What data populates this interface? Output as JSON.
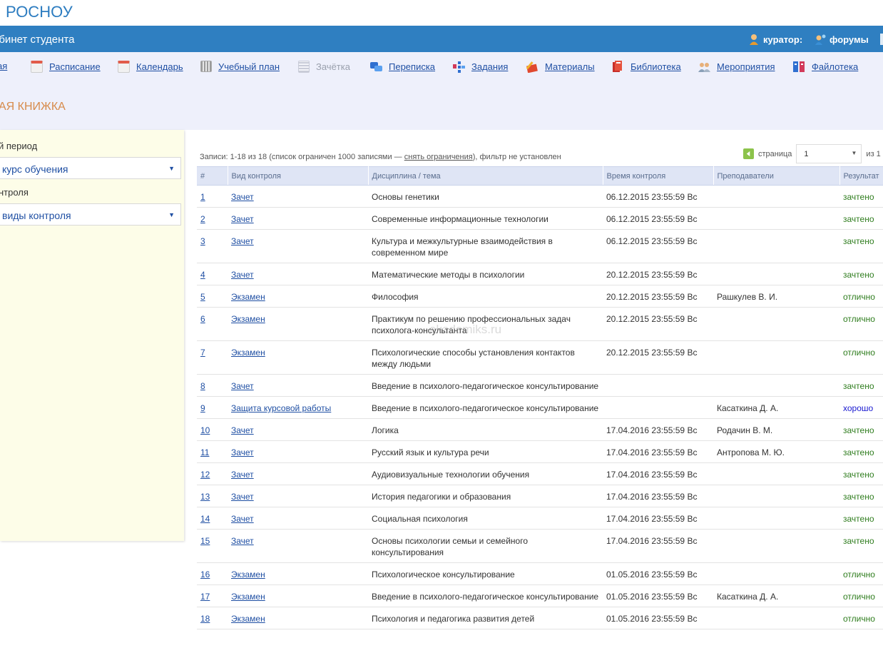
{
  "header": {
    "logo": "РОСНОУ",
    "cabinet_title": "абинет студента",
    "curator_label": "куратор:",
    "forums_label": "форумы"
  },
  "nav": {
    "items": [
      {
        "label": "ая",
        "icon": "home-icon"
      },
      {
        "label": "Расписание",
        "icon": "calendar-icon"
      },
      {
        "label": "Календарь",
        "icon": "calendar-icon"
      },
      {
        "label": "Учебный план",
        "icon": "grid-icon"
      },
      {
        "label": "Зачётка",
        "icon": "gradebook-icon"
      },
      {
        "label": "Переписка",
        "icon": "chat-icon"
      },
      {
        "label": "Задания",
        "icon": "tasks-icon"
      },
      {
        "label": "Материалы",
        "icon": "pencil-book-icon"
      },
      {
        "label": "Библиотека",
        "icon": "books-icon"
      },
      {
        "label": "Мероприятия",
        "icon": "people-icon"
      },
      {
        "label": "Файлотека",
        "icon": "files-icon"
      }
    ]
  },
  "page_title": "АЯ КНИЖКА",
  "sidebar": {
    "period_label": "й период",
    "period_value": "курс обучения",
    "control_label": "нтроля",
    "control_value": "виды контроля"
  },
  "records": {
    "prefix": "Записи: 1-18 из 18 (список ограничен 1000 записями —",
    "link": "снять ограничения",
    "suffix": "), фильтр не установлен"
  },
  "pager": {
    "label": "страница",
    "value": "1",
    "of": "из 1"
  },
  "table": {
    "headers": [
      "#",
      "Вид контроля",
      "Дисциплина / тема",
      "Время контроля",
      "Преподаватели",
      "Результат"
    ],
    "rows": [
      {
        "n": "1",
        "type": "Зачет",
        "subject": "Основы генетики",
        "time": "06.12.2015 23:55:59 Вс",
        "teacher": "",
        "result": "зачтено"
      },
      {
        "n": "2",
        "type": "Зачет",
        "subject": "Современные информационные технологии",
        "time": "06.12.2015 23:55:59 Вс",
        "teacher": "",
        "result": "зачтено"
      },
      {
        "n": "3",
        "type": "Зачет",
        "subject": "Культура и межкультурные взаимодействия в современном мире",
        "time": "06.12.2015 23:55:59 Вс",
        "teacher": "",
        "result": "зачтено"
      },
      {
        "n": "4",
        "type": "Зачет",
        "subject": "Математические методы в психологии",
        "time": "20.12.2015 23:55:59 Вс",
        "teacher": "",
        "result": "зачтено"
      },
      {
        "n": "5",
        "type": "Экзамен",
        "subject": "Философия",
        "time": "20.12.2015 23:55:59 Вс",
        "teacher": "Рашкулев В. И.",
        "result": "отлично"
      },
      {
        "n": "6",
        "type": "Экзамен",
        "subject": "Практикум по решению профессиональных задач психолога-консультанта",
        "time": "20.12.2015 23:55:59 Вс",
        "teacher": "",
        "result": "отлично"
      },
      {
        "n": "7",
        "type": "Экзамен",
        "subject": "Психологические способы установления контактов между людьми",
        "time": "20.12.2015 23:55:59 Вс",
        "teacher": "",
        "result": "отлично"
      },
      {
        "n": "8",
        "type": "Зачет",
        "subject": "Введение в психолого-педагогическое консультирование",
        "time": "",
        "teacher": "",
        "result": "зачтено"
      },
      {
        "n": "9",
        "type": "Защита курсовой работы",
        "subject": "Введение в психолого-педагогическое консультирование",
        "time": "",
        "teacher": "Касаткина Д. А.",
        "result": "хорошо"
      },
      {
        "n": "10",
        "type": "Зачет",
        "subject": "Логика",
        "time": "17.04.2016 23:55:59 Вс",
        "teacher": "Родачин В. М.",
        "result": "зачтено"
      },
      {
        "n": "11",
        "type": "Зачет",
        "subject": "Русский язык и культура речи",
        "time": "17.04.2016 23:55:59 Вс",
        "teacher": "Антропова М. Ю.",
        "result": "зачтено"
      },
      {
        "n": "12",
        "type": "Зачет",
        "subject": "Аудиовизуальные технологии обучения",
        "time": "17.04.2016 23:55:59 Вс",
        "teacher": "",
        "result": "зачтено"
      },
      {
        "n": "13",
        "type": "Зачет",
        "subject": "История педагогики и образования",
        "time": "17.04.2016 23:55:59 Вс",
        "teacher": "",
        "result": "зачтено"
      },
      {
        "n": "14",
        "type": "Зачет",
        "subject": "Социальная психология",
        "time": "17.04.2016 23:55:59 Вс",
        "teacher": "",
        "result": "зачтено"
      },
      {
        "n": "15",
        "type": "Зачет",
        "subject": "Основы психологии семьи и семейного консультирования",
        "time": "17.04.2016 23:55:59 Вс",
        "teacher": "",
        "result": "зачтено"
      },
      {
        "n": "16",
        "type": "Экзамен",
        "subject": "Психологическое консультирование",
        "time": "01.05.2016 23:55:59 Вс",
        "teacher": "",
        "result": "отлично"
      },
      {
        "n": "17",
        "type": "Экзамен",
        "subject": "Введение в психолого-педагогическое консультирование",
        "time": "01.05.2016 23:55:59 Вс",
        "teacher": "Касаткина Д. А.",
        "result": "отлично"
      },
      {
        "n": "18",
        "type": "Экзамен",
        "subject": "Психология и педагогика развития детей",
        "time": "01.05.2016 23:55:59 Вс",
        "teacher": "",
        "result": "отлично"
      }
    ]
  },
  "watermark": "akademiks.ru"
}
